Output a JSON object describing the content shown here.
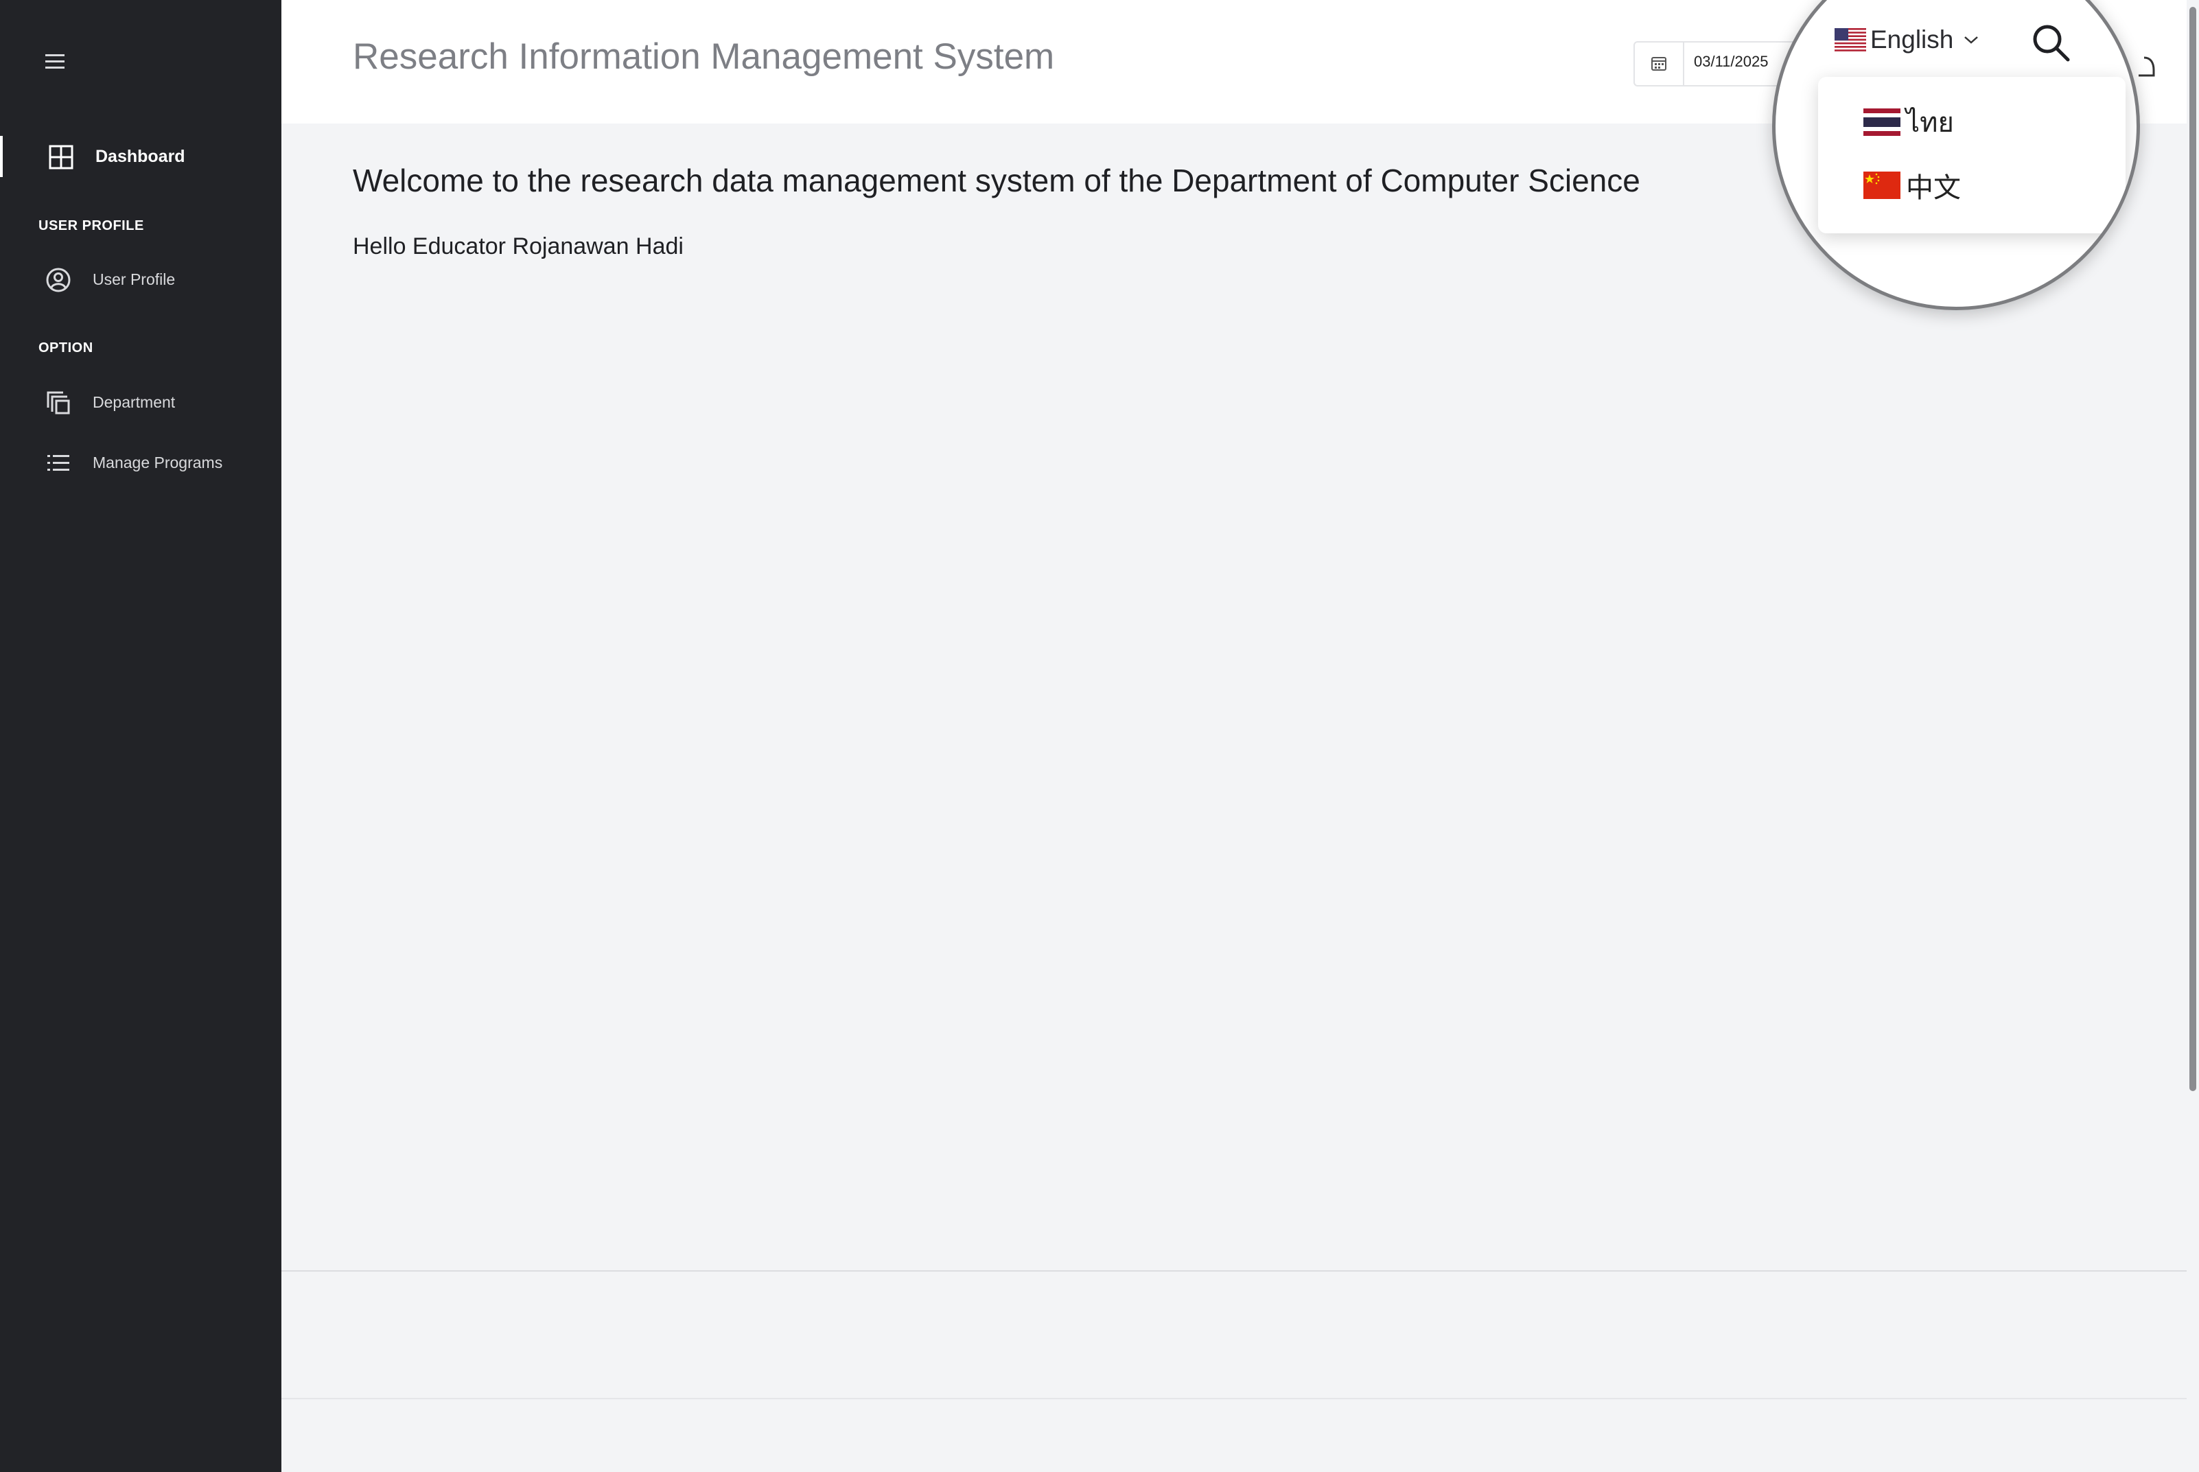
{
  "app": {
    "title": "Research Information Management System"
  },
  "sidebar": {
    "menu_icon": "hamburger-icon",
    "items": [
      {
        "label": "Dashboard",
        "icon": "grid-icon",
        "active": true
      },
      {
        "label": "User Profile",
        "icon": "user-circle-icon",
        "active": false
      },
      {
        "label": "Department",
        "icon": "copy-icon",
        "active": false
      },
      {
        "label": "Manage Programs",
        "icon": "list-icon",
        "active": false
      }
    ],
    "sections": [
      "USER PROFILE",
      "OPTION"
    ]
  },
  "header": {
    "date_value": "03/11/2025",
    "calendar_icon": "calendar-icon",
    "language": {
      "current": "English",
      "current_flag": "us-flag-icon",
      "options": [
        {
          "label": "ไทย",
          "flag": "thai-flag-icon"
        },
        {
          "label": "中文",
          "flag": "china-flag-icon"
        }
      ]
    },
    "search_icon": "search-icon"
  },
  "main": {
    "welcome": "Welcome to the research data management system of the Department of Computer Science",
    "greeting": "Hello Educator Rojanawan Hadi"
  },
  "colors": {
    "sidebar_bg": "#222327",
    "page_bg": "#f3f4f6",
    "title_gray": "#7d7f85"
  }
}
